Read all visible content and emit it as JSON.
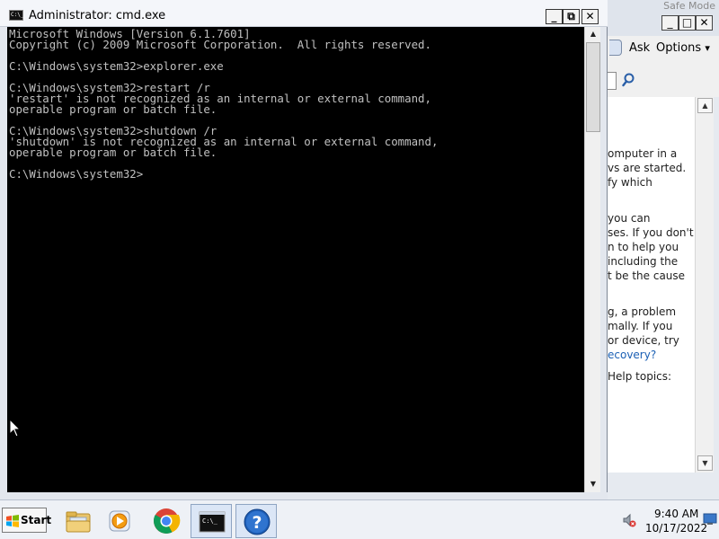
{
  "help_window": {
    "ghost_title": "Safe Mode",
    "controls": {
      "minimize": "_",
      "maximize": "□",
      "close": "✕"
    },
    "toolbar": {
      "ask_label": "Ask",
      "options_label": "Options",
      "options_arrow": "▾"
    },
    "content_lines": [
      "omputer in a",
      "vs are started.",
      "fy which",
      "",
      "you can",
      "ses. If you don't",
      "n to help you",
      "including the",
      "t be the cause",
      "",
      "g, a problem",
      "mally. If you",
      "or device, try",
      "ecovery?",
      "",
      "Help topics:"
    ],
    "scroll": {
      "up": "▲",
      "down": "▼"
    }
  },
  "cmd_window": {
    "title": "Administrator: cmd.exe",
    "icon_text": "C:\\_",
    "controls": {
      "minimize": "_",
      "restore": "⧉",
      "close": "✕"
    },
    "lines": [
      "Microsoft Windows [Version 6.1.7601]",
      "Copyright (c) 2009 Microsoft Corporation.  All rights reserved.",
      "",
      "C:\\Windows\\system32>explorer.exe",
      "",
      "C:\\Windows\\system32>restart /r",
      "'restart' is not recognized as an internal or external command,",
      "operable program or batch file.",
      "",
      "C:\\Windows\\system32>shutdown /r",
      "'shutdown' is not recognized as an internal or external command,",
      "operable program or batch file.",
      "",
      "C:\\Windows\\system32>"
    ],
    "scroll": {
      "up": "▲",
      "down": "▼"
    }
  },
  "taskbar": {
    "start_label": "Start",
    "items": [
      {
        "name": "windows-explorer",
        "icon": "folder-icon"
      },
      {
        "name": "windows-media-player",
        "icon": "media-player-icon"
      },
      {
        "name": "google-chrome",
        "icon": "chrome-icon"
      },
      {
        "name": "command-prompt",
        "icon": "cmd-icon",
        "active": true
      },
      {
        "name": "help-and-support",
        "icon": "help-icon",
        "active": true
      }
    ],
    "clock": {
      "time": "9:40 AM",
      "date": "10/17/2022"
    }
  },
  "colors": {
    "console_bg": "#000000",
    "console_text": "#c0c0c0",
    "link": "#1a5fb4",
    "chrome_red": "#db4437",
    "chrome_green": "#0f9d58",
    "chrome_yellow": "#f4b400",
    "chrome_blue": "#4285f4",
    "help_blue": "#1e5fb8"
  }
}
